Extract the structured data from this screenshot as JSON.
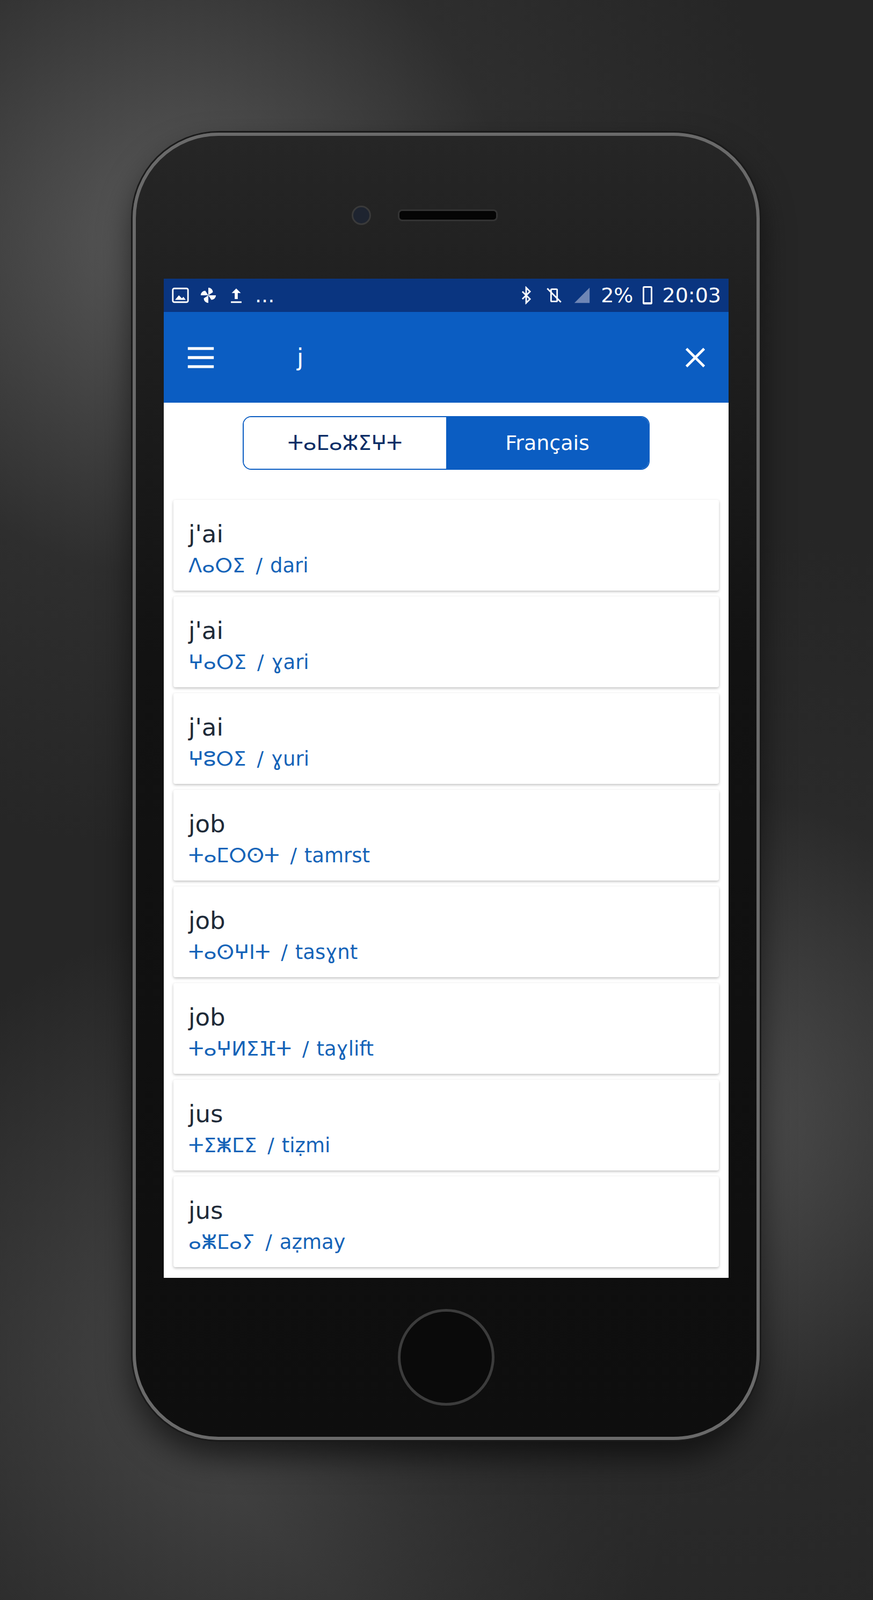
{
  "status_bar": {
    "more": "...",
    "battery": "2%",
    "battery_level": 0.02,
    "time": "20:03"
  },
  "app_bar": {
    "query": "j"
  },
  "tabs": [
    {
      "label": "ⵜⴰⵎⴰⵣⵉⵖⵜ",
      "selected": false
    },
    {
      "label": "Français",
      "selected": true
    }
  ],
  "separator": "/",
  "entries": [
    {
      "word": "j'ai",
      "tifinagh": "ⴷⴰⵔⵉ",
      "latin": "dari"
    },
    {
      "word": "j'ai",
      "tifinagh": "ⵖⴰⵔⵉ",
      "latin": "ɣari"
    },
    {
      "word": "j'ai",
      "tifinagh": "ⵖⵓⵔⵉ",
      "latin": "ɣuri"
    },
    {
      "word": "job",
      "tifinagh": "ⵜⴰⵎⵔⵙⵜ",
      "latin": "tamrst"
    },
    {
      "word": "job",
      "tifinagh": "ⵜⴰⵙⵖⵏⵜ",
      "latin": "tasɣnt"
    },
    {
      "word": "job",
      "tifinagh": "ⵜⴰⵖⵍⵉⴼⵜ",
      "latin": "taɣlift"
    },
    {
      "word": "jus",
      "tifinagh": "ⵜⵉⵥⵎⵉ",
      "latin": "tiẓmi"
    },
    {
      "word": "jus",
      "tifinagh": "ⴰⵥⵎⴰⵢ",
      "latin": "aẓmay"
    }
  ]
}
